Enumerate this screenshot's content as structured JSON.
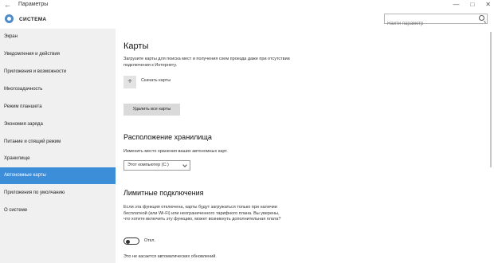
{
  "window": {
    "back_glyph": "←",
    "title": "Параметры",
    "minimize_glyph": "—",
    "maximize_glyph": "□",
    "close_glyph": "✕"
  },
  "header": {
    "section_title": "СИСТЕМА",
    "search_placeholder": "Найти параметр"
  },
  "sidebar": {
    "items": [
      {
        "label": "Экран"
      },
      {
        "label": "Уведомления и действия"
      },
      {
        "label": "Приложения и возможности"
      },
      {
        "label": "Многозадачность"
      },
      {
        "label": "Режим планшета"
      },
      {
        "label": "Экономия заряда"
      },
      {
        "label": "Питание и спящий режим"
      },
      {
        "label": "Хранилище"
      },
      {
        "label": "Автономные карты"
      },
      {
        "label": "Приложения по умолчанию"
      },
      {
        "label": "О системе"
      }
    ],
    "selected_index": 8
  },
  "main": {
    "maps": {
      "heading": "Карты",
      "description": "Загрузите карты для поиска мест и получения схем проезда даже при отсутствии подключения к Интернету.",
      "download_label": "Скачать карты",
      "delete_all_button": "Удалить все карты"
    },
    "storage": {
      "heading": "Расположение хранилища",
      "description": "Изменить место хранения ваших автономных карт.",
      "location_value": "Этот компьютер (C:)"
    },
    "metered": {
      "heading": "Лимитные подключения",
      "description": "Если эта функция отключена, карты будут загружаться только при наличии бесплатной (или Wi-Fi) или неограниченного тарифного плана. Вы уверены, что хотите включить эту функцию, может возникнуть дополнительная плата?",
      "toggle_state": "Откл.",
      "footnote": "Это не касается автоматических обновлений."
    }
  }
}
